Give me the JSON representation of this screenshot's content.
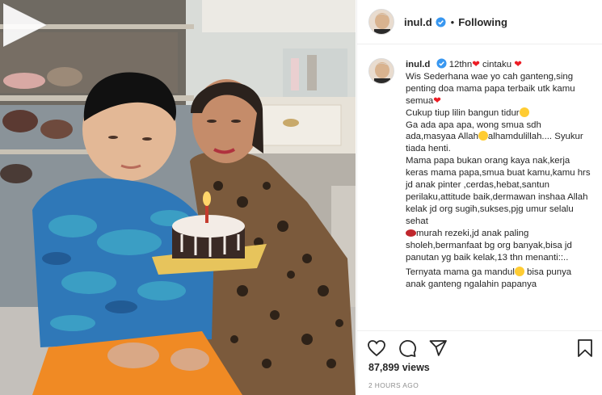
{
  "header": {
    "username": "inul.d",
    "separator": "•",
    "follow_label": "Following"
  },
  "caption": {
    "username": "inul.d",
    "lines": [
      "12thn",
      "cintaku",
      "Wis Sederhana wae yo cah ganteng,sing penting doa mama papa terbaik utk kamu semua",
      "Cukup tiup lilin bangun tidur",
      "Ga ada apa apa, wong smua sdh ada,masyaa Allah",
      "alhamdulillah.... Syukur tiada henti.",
      "Mama papa bukan orang kaya nak,kerja keras mama papa,smua buat kamu,kamu hrs jd anak pinter ,cerdas,hebat,santun perilaku,attitude baik,dermawan inshaa Allah kelak jd org sugih,sukses,pjg umur selalu sehat",
      "murah rezeki,jd anak paling sholeh,bermanfaat bg org banyak,bisa jd panutan yg baik kelak,13 thn menanti::..",
      "Ternyata mama ga mandul",
      "bisa punya anak ganteng ngalahin papanya"
    ]
  },
  "stats": {
    "views": "87,899 views",
    "time_ago": "2 HOURS AGO"
  },
  "icons": {
    "verified": "verified-badge-icon",
    "like": "heart-icon",
    "comment": "comment-icon",
    "share": "share-icon",
    "save": "bookmark-icon",
    "play": "play-icon"
  },
  "colors": {
    "verified_blue": "#3897f0",
    "heart_red": "#ed1c24",
    "muted_text": "#8e8e8e",
    "border": "#efefef"
  }
}
